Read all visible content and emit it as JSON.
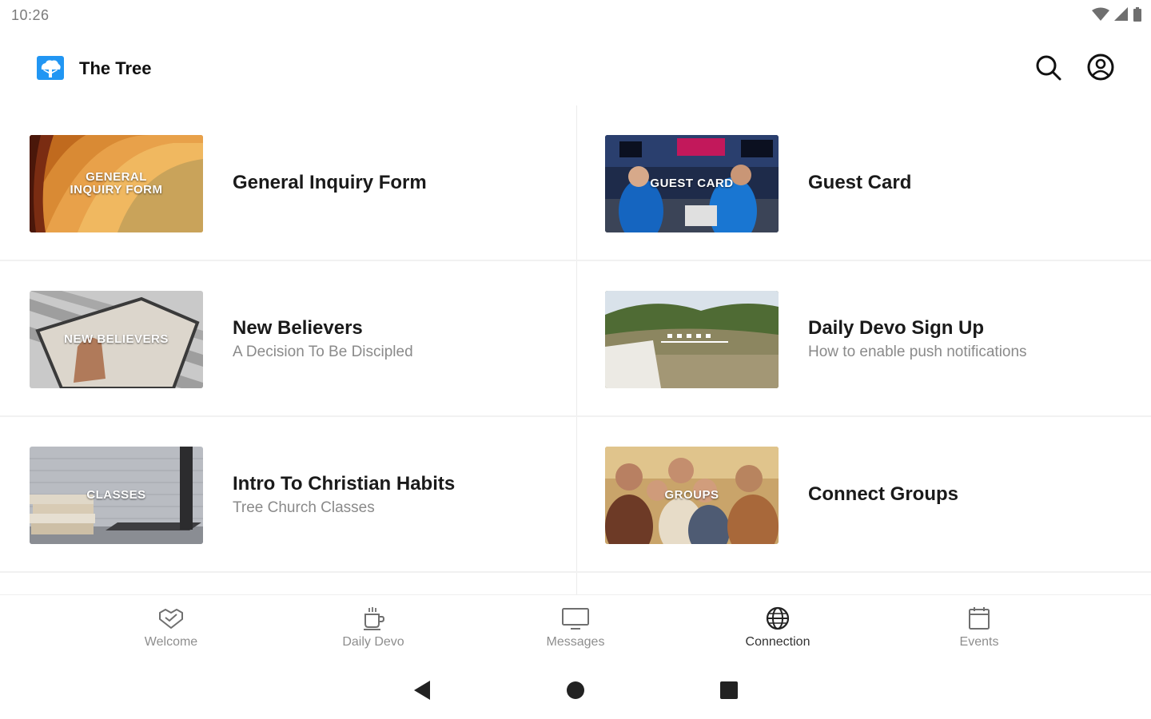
{
  "status_bar": {
    "time": "10:26"
  },
  "app_bar": {
    "title": "The Tree",
    "icons": [
      "tree-logo-icon",
      "search-icon",
      "account-circle-icon"
    ]
  },
  "cards": [
    {
      "title": "General Inquiry Form",
      "subtitle": "",
      "thumb_label": "GENERAL INQUIRY FORM"
    },
    {
      "title": "Guest Card",
      "subtitle": "",
      "thumb_label": "GUEST CARD"
    },
    {
      "title": "New Believers",
      "subtitle": "A Decision To Be Discipled",
      "thumb_label": "NEW BELIEVERS"
    },
    {
      "title": "Daily Devo Sign Up",
      "subtitle": "How to enable push notifications",
      "thumb_label": ""
    },
    {
      "title": "Intro To Christian Habits",
      "subtitle": "Tree Church Classes",
      "thumb_label": "CLASSES"
    },
    {
      "title": "Connect Groups",
      "subtitle": "",
      "thumb_label": "GROUPS"
    }
  ],
  "bottom_nav": [
    {
      "label": "Welcome",
      "icon": "welcome-heart-icon"
    },
    {
      "label": "Daily Devo",
      "icon": "coffee-cup-icon"
    },
    {
      "label": "Messages",
      "icon": "monitor-icon"
    },
    {
      "label": "Connection",
      "icon": "globe-icon",
      "active": true
    },
    {
      "label": "Events",
      "icon": "calendar-icon"
    }
  ],
  "system_nav": [
    "back-icon",
    "home-icon",
    "recents-icon"
  ],
  "colors": {
    "logo_blue": "#2196f3",
    "text_primary": "#1a1a1a",
    "text_secondary": "#8a8a8a",
    "divider": "#ececec"
  }
}
